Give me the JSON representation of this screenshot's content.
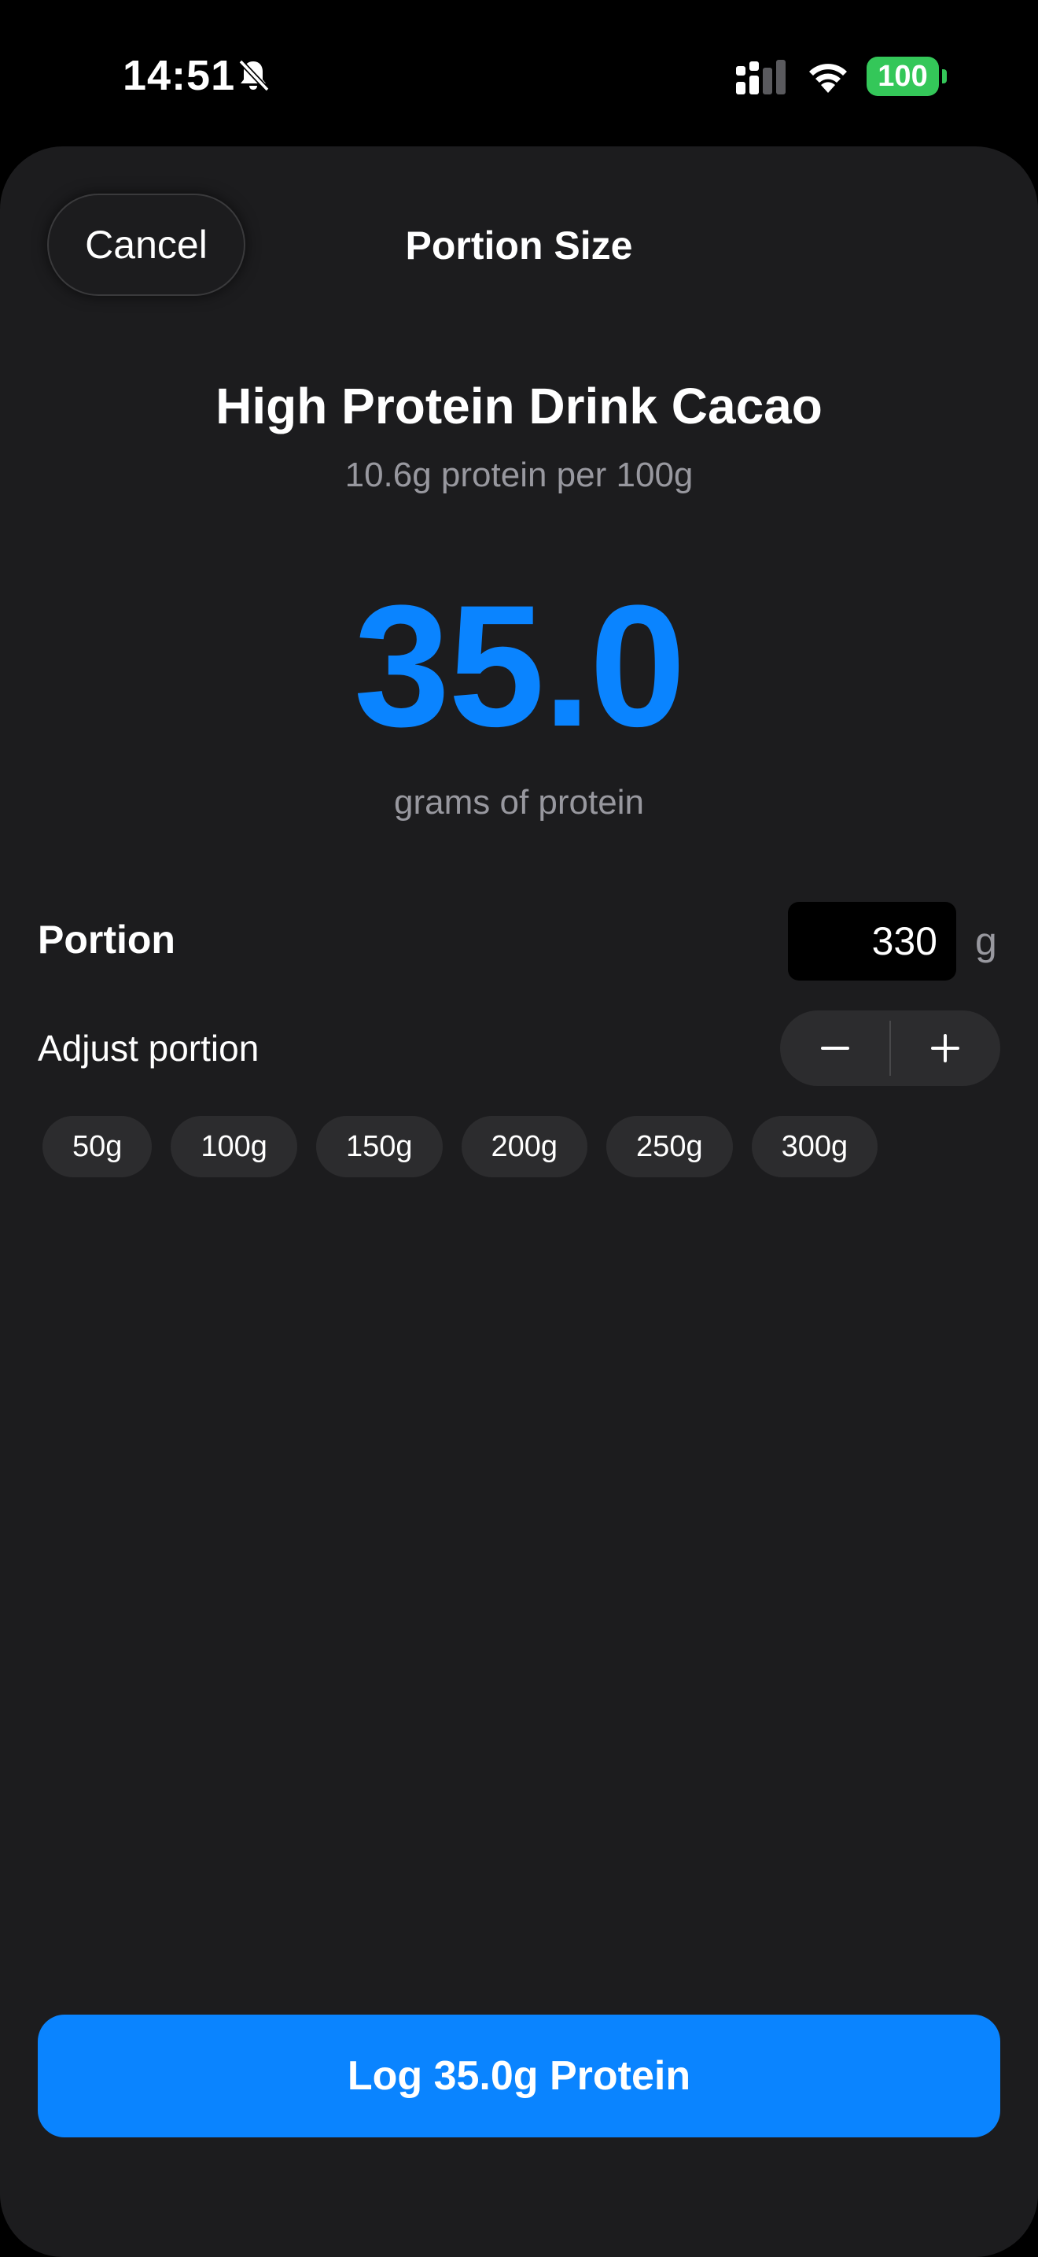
{
  "status_bar": {
    "time": "14:51",
    "battery": "100",
    "battery_color": "#34c759",
    "icons": [
      "bell-slash-icon",
      "signal-icon",
      "wifi-icon",
      "battery-icon"
    ]
  },
  "nav": {
    "cancel_label": "Cancel",
    "title": "Portion Size"
  },
  "food": {
    "name": "High Protein Drink Cacao",
    "subtitle": "10.6g protein per 100g"
  },
  "protein": {
    "value": "35.0",
    "unit_label": "grams of protein",
    "accent_color": "#0a84ff"
  },
  "portion": {
    "label": "Portion",
    "value": "330",
    "unit": "g"
  },
  "adjust": {
    "label": "Adjust portion",
    "decrement_icon": "minus-icon",
    "increment_icon": "plus-icon"
  },
  "quick_portions": [
    "50g",
    "100g",
    "150g",
    "200g",
    "250g",
    "300g"
  ],
  "log_button": {
    "label": "Log 35.0g Protein"
  }
}
